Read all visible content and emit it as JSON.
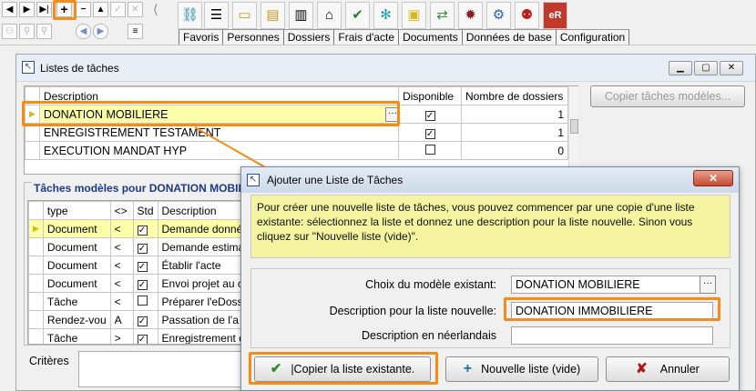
{
  "tabs": [
    "Favoris",
    "Personnes",
    "Dossiers",
    "Frais d'acte",
    "Documents",
    "Données de base",
    "Configuration"
  ],
  "main_window": {
    "title": "Listes de tâches",
    "columns": [
      "Description",
      "Disponible",
      "Nombre de dossiers"
    ],
    "rows": [
      {
        "description": "DONATION MOBILIERE",
        "available": true,
        "count": "1"
      },
      {
        "description": "ENREGISTREMENT TESTAMENT",
        "available": true,
        "count": "1"
      },
      {
        "description": "EXECUTION MANDAT HYP",
        "available": false,
        "count": "0"
      }
    ],
    "copy_button": "Copier tâches modèles...",
    "tasks_title": "Tâches modèles pour DONATION MOBILIE",
    "task_columns": [
      "type",
      "<>",
      "Std",
      "Description"
    ],
    "tasks": [
      {
        "type": "Document",
        "dir": "<",
        "std": true,
        "desc": "Demande donné"
      },
      {
        "type": "Document",
        "dir": "<",
        "std": true,
        "desc": "Demande estima"
      },
      {
        "type": "Document",
        "dir": "<",
        "std": true,
        "desc": "Établir l'acte"
      },
      {
        "type": "Document",
        "dir": "<",
        "std": true,
        "desc": "Envoi projet au c"
      },
      {
        "type": "Tâche",
        "dir": "<",
        "std": false,
        "desc": "Préparer l'eDoss"
      },
      {
        "type": "Rendez-vou",
        "dir": "A",
        "std": true,
        "desc": "Passation de l'a"
      },
      {
        "type": "Tâche",
        "dir": ">",
        "std": true,
        "desc": "Enregistrement d"
      }
    ],
    "criteria_label": "Critères"
  },
  "dialog": {
    "title": "Ajouter une Liste de Tâches",
    "info": "Pour créer une nouvelle liste de tâches, vous pouvez commencer par une copie d'une liste existante: sélectionnez la liste et donnez une description pour la liste nouvelle. Sinon vous cliquez sur \"Nouvelle liste (vide)\".",
    "label_model": "Choix du modèle existant:",
    "value_model": "DONATION MOBILIERE",
    "label_desc": "Description pour la liste nouvelle:",
    "value_desc": "DONATION IMMOBILIERE",
    "label_nl": "Description en néerlandais",
    "value_nl": "",
    "btn_copy": "|Copier la liste existante.",
    "btn_new": "Nouvelle liste (vide)",
    "btn_cancel": "Annuler"
  },
  "colors": {
    "highlight": "#f28c1a",
    "info_bg": "#f3f3a0",
    "check": "#2e8b2e",
    "plus": "#1f6fb2",
    "cancel": "#b01818"
  }
}
